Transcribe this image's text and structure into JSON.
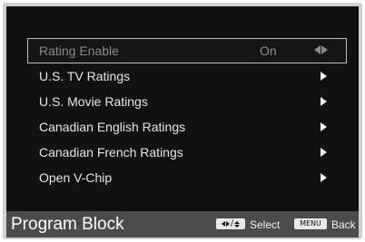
{
  "menu": {
    "items": [
      {
        "label": "Rating Enable",
        "value": "On",
        "selected": true
      },
      {
        "label": "U.S. TV Ratings"
      },
      {
        "label": "U.S. Movie Ratings"
      },
      {
        "label": "Canadian English Ratings"
      },
      {
        "label": "Canadian French Ratings"
      },
      {
        "label": "Open V-Chip"
      }
    ]
  },
  "footer": {
    "title": "Program Block",
    "select_label": "Select",
    "menu_key_label": "MENU",
    "back_label": "Back",
    "nav_key_separator": "/"
  },
  "colors": {
    "panel_background": "#111111",
    "footer_background": "#4c4c4c",
    "selected_border": "#bdbdbd",
    "dimmed_text": "#8a8a8a",
    "text": "#e6e6e6"
  },
  "icons": {
    "row_arrow": "triangle-right-icon",
    "value_adjust": "left-right-arrows-icon",
    "nav_key": "arrow-keys-icon"
  }
}
